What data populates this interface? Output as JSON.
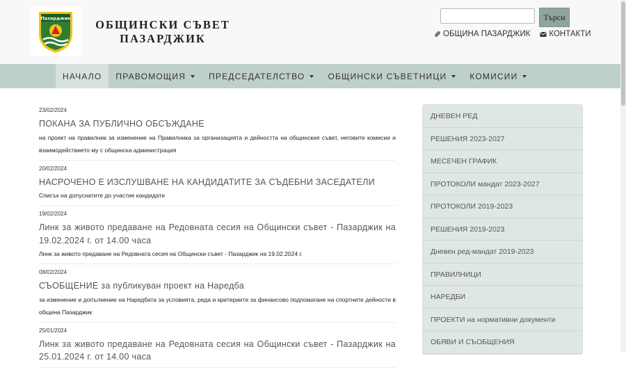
{
  "header": {
    "title_line1": "ОБЩИНСКИ СЪВЕТ",
    "title_line2": "ПАЗАРДЖИК",
    "logo_text": "Пазарджик",
    "search": {
      "placeholder": "",
      "button_label": "Търси"
    },
    "links": [
      {
        "label": "ОБЩИНА ПАЗАРДЖИК",
        "icon": "link-icon"
      },
      {
        "label": "КОНТАКТИ",
        "icon": "envelope-icon"
      }
    ]
  },
  "nav": [
    {
      "label": "НАЧАЛО"
    },
    {
      "label": "ПРАВОМОЩИЯ"
    },
    {
      "label": "ПРЕДСЕДАТЕЛСТВО"
    },
    {
      "label": "ОБЩИНСКИ СЪВЕТНИЦИ"
    },
    {
      "label": "КОМИСИИ"
    }
  ],
  "news": [
    {
      "date": "23/02/2024",
      "title": "ПОКАНА ЗА ПУБЛИЧНО ОБСЪЖДАНЕ",
      "desc": "на проект на правилник за изменение на Правилника за организацията и дейността на общинския съвет, неговите комисии и взаимодействието му с общинска администрация"
    },
    {
      "date": "20/02/2024",
      "title": "НАСРОЧЕНО Е ИЗСЛУШВАНЕ НА КАНДИДАТИТЕ ЗА СЪДЕБНИ ЗАСЕДАТЕЛИ",
      "desc": "Списък на допуснатите до участие кандидати"
    },
    {
      "date": "19/02/2024",
      "title": "Линк за живото предаване на Редовната сесия на Общински съвет - Пазарджик на 19.02.2024 г. от 14.00 часа",
      "desc": "Линк за живото предаване на Редовната сесия на Общински съвет - Пазарджик на 19.02.2024 г."
    },
    {
      "date": "08/02/2024",
      "title": "СЪОБЩЕНИЕ за публикуван проект на Наредба",
      "desc": "за изменение и допълнение на Наредбата за условията, реда и критериите за финансово подпомагане на спортните дейности в община Пазарджик"
    },
    {
      "date": "25/01/2024",
      "title": "Линк за живото предаване на Редовната сесия на Общински съвет - Пазарджик на 25.01.2024 г. от 14.00 часа",
      "desc": ""
    }
  ],
  "sidebar": [
    "ДНЕВЕН РЕД",
    "РЕШЕНИЯ 2023-2027",
    "МЕСЕЧЕН ГРАФИК",
    "ПРОТОКОЛИ мандат 2023-2027",
    "ПРОТОКОЛИ 2019-2023",
    "РЕШЕНИЯ 2019-2023",
    "Дневен ред-мандат 2019-2023",
    "ПРАВИЛНИЦИ",
    "НАРЕДБИ",
    "ПРОЕКТИ на нормативни документи",
    "ОБЯВИ И СЪОБЩЕНИЯ"
  ],
  "colors": {
    "nav_bg": "#bfcfca",
    "sidebar_bg": "#dfe7e4",
    "crest_green": "#2e7d32",
    "crest_yellow": "#f2c21b"
  }
}
